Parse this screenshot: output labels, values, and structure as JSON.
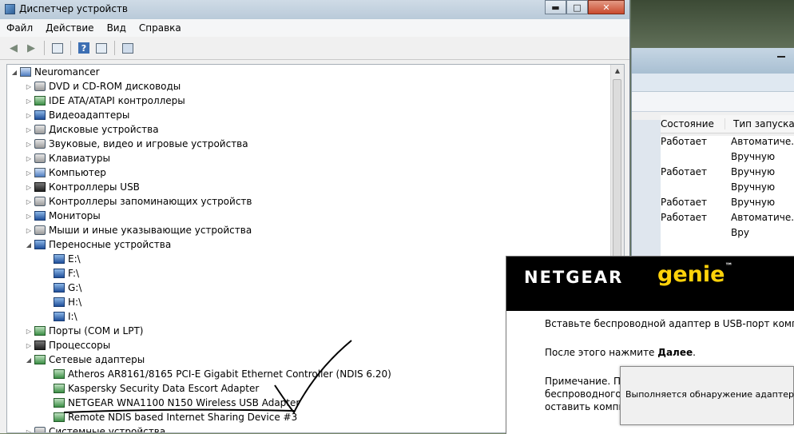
{
  "device_manager": {
    "title": "Диспетчер устройств",
    "caption": {
      "minimize": "▬",
      "maximize": "□",
      "close": "✕"
    },
    "menu": [
      "Файл",
      "Действие",
      "Вид",
      "Справка"
    ],
    "tree": {
      "root": "Neuromancer",
      "items": [
        {
          "label": "DVD и CD-ROM дисководы",
          "icon": "dvd-drive-icon"
        },
        {
          "label": "IDE ATA/ATAPI контроллеры",
          "icon": "ide-controller-icon"
        },
        {
          "label": "Видеоадаптеры",
          "icon": "video-adapter-icon"
        },
        {
          "label": "Дисковые устройства",
          "icon": "disk-drive-icon"
        },
        {
          "label": "Звуковые, видео и игровые устройства",
          "icon": "speaker-icon"
        },
        {
          "label": "Клавиатуры",
          "icon": "keyboard-icon"
        },
        {
          "label": "Компьютер",
          "icon": "computer-icon"
        },
        {
          "label": "Контроллеры USB",
          "icon": "usb-icon"
        },
        {
          "label": "Контроллеры запоминающих устройств",
          "icon": "storage-controller-icon"
        },
        {
          "label": "Мониторы",
          "icon": "monitor-icon"
        },
        {
          "label": "Мыши и иные указывающие устройства",
          "icon": "mouse-icon"
        },
        {
          "label": "Переносные устройства",
          "icon": "portable-device-icon",
          "expanded": true,
          "children": [
            "E:\\",
            "F:\\",
            "G:\\",
            "H:\\",
            "I:\\"
          ]
        },
        {
          "label": "Порты (COM и LPT)",
          "icon": "port-icon"
        },
        {
          "label": "Процессоры",
          "icon": "processor-icon"
        },
        {
          "label": "Сетевые адаптеры",
          "icon": "network-adapter-icon",
          "expanded": true,
          "children": [
            "Atheros AR8161/8165 PCI-E Gigabit Ethernet Controller (NDIS 6.20)",
            "Kaspersky Security Data Escort Adapter",
            "NETGEAR WNA1100 N150 Wireless USB Adapter",
            "Remote NDIS based Internet Sharing Device #3"
          ]
        },
        {
          "label": "Системные устройства",
          "icon": "system-device-icon"
        }
      ]
    }
  },
  "services_window": {
    "columns": [
      "Состояние",
      "Тип запуска"
    ],
    "rows": [
      [
        "Работает",
        "Автоматиче..."
      ],
      [
        "",
        "Вручную"
      ],
      [
        "Работает",
        "Вручную"
      ],
      [
        "",
        "Вручную"
      ],
      [
        "Работает",
        "Вручную"
      ],
      [
        "Работает",
        "Автоматиче..."
      ],
      [
        "",
        "Вру"
      ]
    ]
  },
  "genie": {
    "brand": "NETGEAR",
    "product": "genie",
    "tm": "™",
    "line1": "Вставьте беспроводной адаптер в USB-порт компьюте",
    "line2_prefix": "После этого нажмите ",
    "line2_bold": "Далее",
    "line2_suffix": ".",
    "note1": "Примечание. Пр",
    "note2": "беспроводного U",
    "note3": "оставить компь"
  },
  "progress_popup": {
    "text": "Выполняется обнаружение адаптера...."
  },
  "colors": {
    "genie_yellow": "#ffd20a",
    "annotation_ink": "#000000"
  }
}
